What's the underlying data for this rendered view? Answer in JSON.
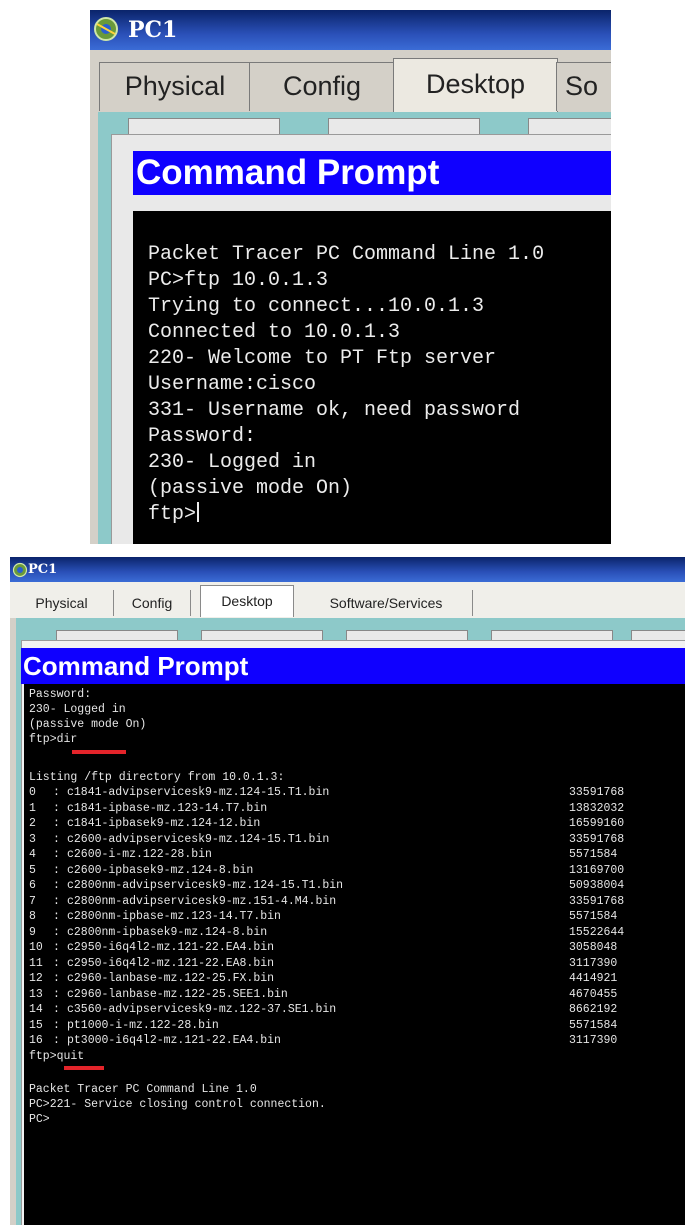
{
  "win1": {
    "title": "PC1",
    "tabs": [
      "Physical",
      "Config",
      "Desktop",
      "So"
    ],
    "active_tab": "Desktop",
    "cmd_title": "Command Prompt",
    "lines": [
      "Packet Tracer PC Command Line 1.0",
      "PC>ftp 10.0.1.3",
      "Trying to connect...10.0.1.3",
      "Connected to 10.0.1.3",
      "220- Welcome to PT Ftp server",
      "Username:cisco",
      "331- Username ok, need password",
      "Password:",
      "230- Logged in",
      "(passive mode On)",
      "ftp>"
    ]
  },
  "win2": {
    "title": "PC1",
    "tabs": [
      "Physical",
      "Config",
      "Desktop",
      "Software/Services"
    ],
    "active_tab": "Desktop",
    "cmd_title": "Command Prompt",
    "header_lines": [
      "Password:",
      "230- Logged in",
      "(passive mode On)",
      "ftp>dir"
    ],
    "listing_header": "Listing /ftp directory from 10.0.1.3:",
    "files": [
      {
        "index": "0",
        "name": "c1841-advipservicesk9-mz.124-15.T1.bin",
        "size": "33591768"
      },
      {
        "index": "1",
        "name": "c1841-ipbase-mz.123-14.T7.bin",
        "size": "13832032"
      },
      {
        "index": "2",
        "name": "c1841-ipbasek9-mz.124-12.bin",
        "size": "16599160"
      },
      {
        "index": "3",
        "name": "c2600-advipservicesk9-mz.124-15.T1.bin",
        "size": "33591768"
      },
      {
        "index": "4",
        "name": "c2600-i-mz.122-28.bin",
        "size": "5571584"
      },
      {
        "index": "5",
        "name": "c2600-ipbasek9-mz.124-8.bin",
        "size": "13169700"
      },
      {
        "index": "6",
        "name": "c2800nm-advipservicesk9-mz.124-15.T1.bin",
        "size": "50938004"
      },
      {
        "index": "7",
        "name": "c2800nm-advipservicesk9-mz.151-4.M4.bin",
        "size": "33591768"
      },
      {
        "index": "8",
        "name": "c2800nm-ipbase-mz.123-14.T7.bin",
        "size": "5571584"
      },
      {
        "index": "9",
        "name": "c2800nm-ipbasek9-mz.124-8.bin",
        "size": "15522644"
      },
      {
        "index": "10",
        "name": "c2950-i6q4l2-mz.121-22.EA4.bin",
        "size": "3058048"
      },
      {
        "index": "11",
        "name": "c2950-i6q4l2-mz.121-22.EA8.bin",
        "size": "3117390"
      },
      {
        "index": "12",
        "name": "c2960-lanbase-mz.122-25.FX.bin",
        "size": "4414921"
      },
      {
        "index": "13",
        "name": "c2960-lanbase-mz.122-25.SEE1.bin",
        "size": "4670455"
      },
      {
        "index": "14",
        "name": "c3560-advipservicesk9-mz.122-37.SE1.bin",
        "size": "8662192"
      },
      {
        "index": "15",
        "name": "pt1000-i-mz.122-28.bin",
        "size": "5571584"
      },
      {
        "index": "16",
        "name": "pt3000-i6q4l2-mz.121-22.EA4.bin",
        "size": "3117390"
      }
    ],
    "sep": ":",
    "quit_line": "ftp>quit",
    "footer_lines": [
      "Packet Tracer PC Command Line 1.0",
      "PC>221- Service closing control connection.",
      "PC>"
    ]
  },
  "colors": {
    "titlebar": "#0a246a",
    "cmd_header": "#0f00ff",
    "desk": "#8dc9c9",
    "terminal_bg": "#000000",
    "terminal_text": "#e6e6e6",
    "highlight_underline": "#e4242a"
  },
  "icons": [
    "packet-tracer-pc-icon"
  ]
}
